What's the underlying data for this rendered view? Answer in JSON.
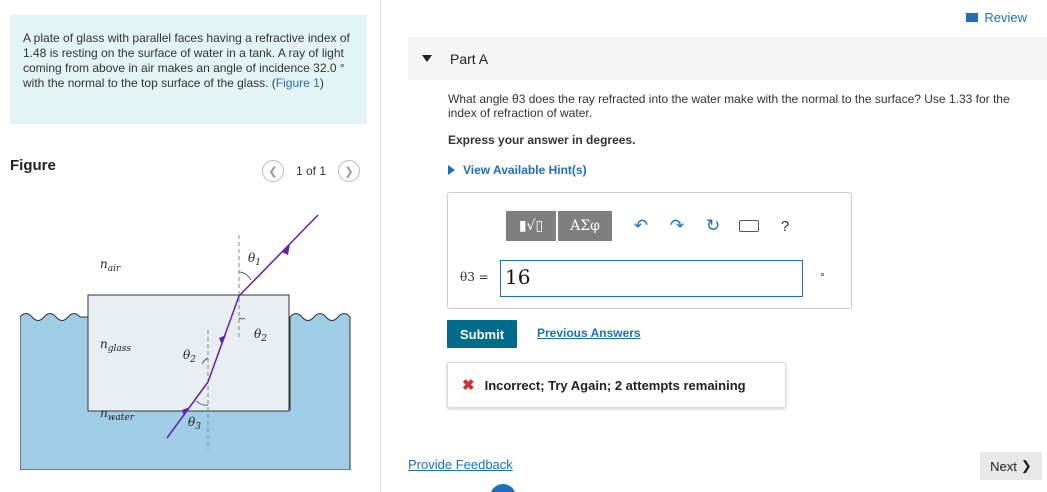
{
  "problem": {
    "text": "A plate of glass with parallel faces having a refractive index of 1.48 is resting on the surface of water in a tank. A ray of light coming from above in air makes an angle of incidence 32.0 ° with the normal to the top surface of the glass. (",
    "link": "Figure 1",
    "close": ")"
  },
  "figure": {
    "title": "Figure",
    "pager": "1 of 1",
    "prev_icon": "chevron-left",
    "next_icon": "chevron-right",
    "labels": {
      "n_air": "n",
      "n_air_sub": "air",
      "n_glass": "n",
      "n_glass_sub": "glass",
      "n_water": "n",
      "n_water_sub": "water",
      "theta1": "θ",
      "theta1_sub": "1",
      "theta2a": "θ",
      "theta2a_sub": "2",
      "theta2b": "θ",
      "theta2b_sub": "2",
      "theta3": "θ",
      "theta3_sub": "3"
    },
    "colors": {
      "water": "#9fcde6",
      "glass": "#e9eef2",
      "ray": "#6a1fa6"
    }
  },
  "header": {
    "review": "Review"
  },
  "part": {
    "title": "Part A"
  },
  "question": "What angle θ3 does the ray refracted into the water make with the normal to the surface? Use 1.33 for the index of refraction of water.",
  "instructions": "Express your answer in degrees.",
  "hints": "View Available Hint(s)",
  "toolbar": {
    "template": "▮√▯",
    "greek": "ΑΣφ",
    "undo": "↶",
    "redo": "↷",
    "reset": "↻",
    "help": "?"
  },
  "answer": {
    "label": "θ3 =",
    "value": "16",
    "unit": "°"
  },
  "buttons": {
    "submit": "Submit",
    "previous": "Previous Answers"
  },
  "feedback": {
    "icon": "✖",
    "message": "Incorrect; Try Again; 2 attempts remaining"
  },
  "footer": {
    "provide": "Provide Feedback",
    "next": "Next",
    "next_icon": "❯"
  }
}
